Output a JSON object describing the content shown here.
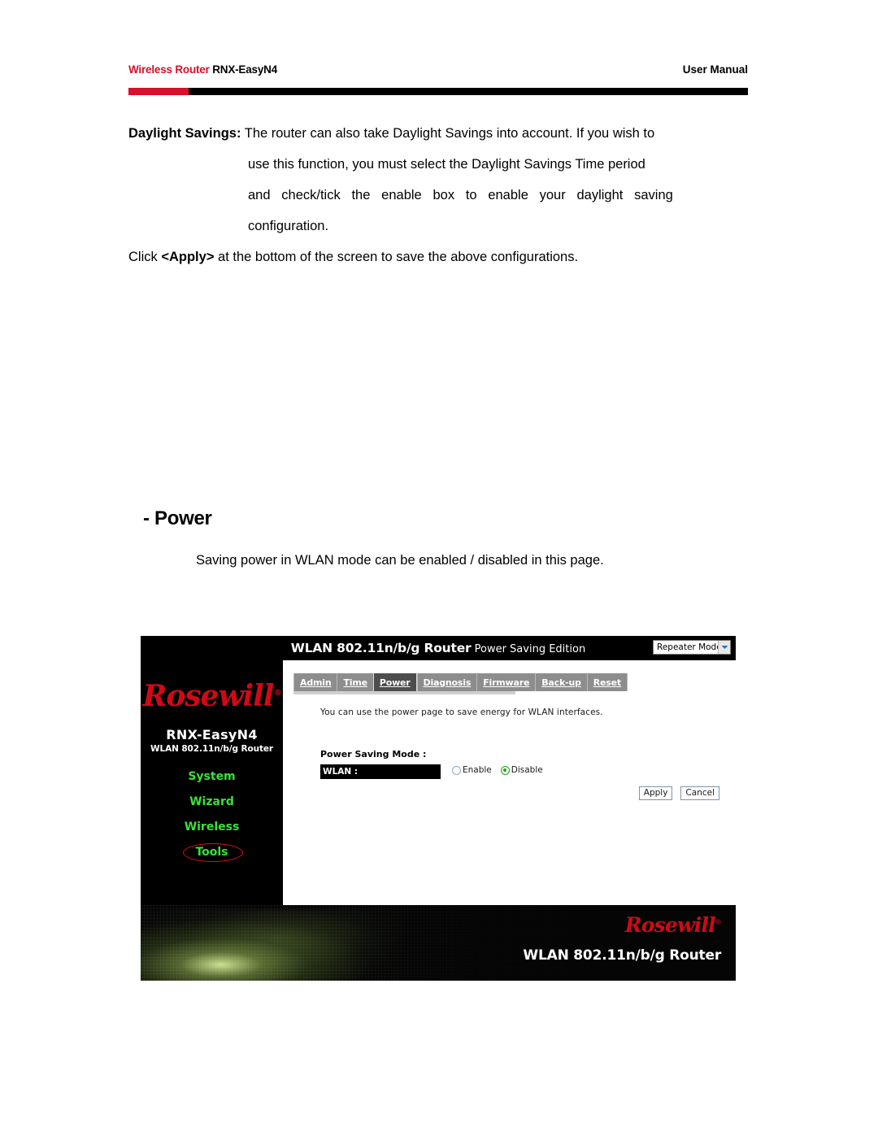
{
  "header": {
    "brand_prefix": "Wireless Router ",
    "model": "RNX-EasyN4",
    "doc_type": "User Manual",
    "accent_red": "#d8102a",
    "rule_black": "#000000"
  },
  "body": {
    "daylight": {
      "lead": "Daylight Savings:",
      "line1": " The router can also take Daylight Savings into account. If you wish to",
      "line2": "use this function, you must select the Daylight Savings Time period",
      "line3": "and check/tick the enable box to enable your daylight saving",
      "line4": "configuration."
    },
    "apply_note": {
      "before": "Click ",
      "bold": "<Apply>",
      "after": " at the bottom of the screen to save the above configurations."
    }
  },
  "section": {
    "heading": "- Power",
    "subtext": "Saving power in WLAN mode can be enabled / disabled in this page."
  },
  "router_ui": {
    "titlebar": {
      "title_bold": "WLAN 802.11n/b/g Router",
      "title_light": " Power Saving Edition",
      "mode_select_value": "Repeater Mode"
    },
    "sidebar": {
      "logo_text": "Rosewill",
      "model": "RNX-EasyN4",
      "model_sub": "WLAN 802.11n/b/g Router",
      "menu": [
        {
          "label": "System",
          "highlighted": false
        },
        {
          "label": "Wizard",
          "highlighted": false
        },
        {
          "label": "Wireless",
          "highlighted": false
        },
        {
          "label": "Tools",
          "highlighted": true
        }
      ],
      "menu_color": "#39e339",
      "annotation_color": "#e01010"
    },
    "tabs": [
      {
        "label": "Admin",
        "active": false
      },
      {
        "label": "Time",
        "active": false
      },
      {
        "label": "Power",
        "active": true
      },
      {
        "label": "Diagnosis",
        "active": false
      },
      {
        "label": "Firmware",
        "active": false
      },
      {
        "label": "Back-up",
        "active": false
      },
      {
        "label": "Reset",
        "active": false
      }
    ],
    "content": {
      "description": "You can use the power page to save energy for WLAN interfaces.",
      "mode_label": "Power Saving Mode :",
      "wlan_field_label": "WLAN :",
      "radios": [
        {
          "label": "Enable",
          "selected": false
        },
        {
          "label": "Disable",
          "selected": true
        }
      ],
      "apply_button": "Apply",
      "cancel_button": "Cancel"
    },
    "footer": {
      "logo_text": "Rosewill",
      "tagline": "WLAN 802.11n/b/g Router"
    }
  }
}
